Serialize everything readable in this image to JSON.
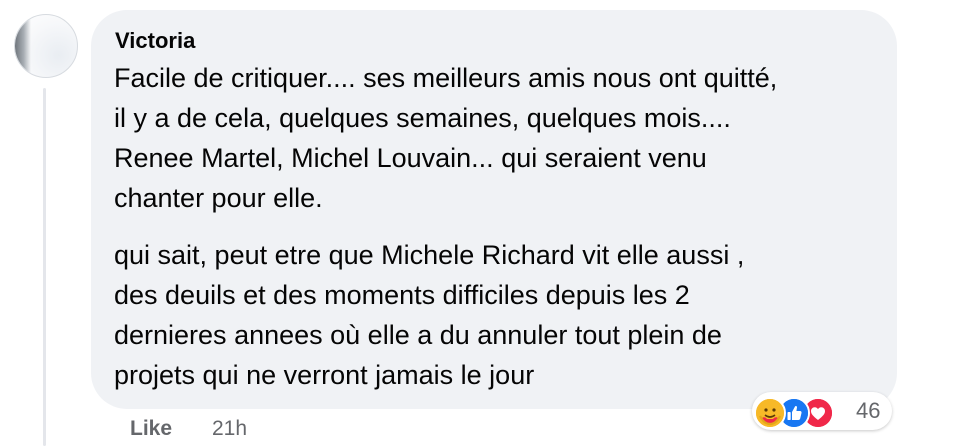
{
  "comment": {
    "author": "Victoria",
    "paragraphs": [
      {
        "lines": [
          "Facile de critiquer.... ses meilleurs amis nous ont quitté,",
          "il y a de cela, quelques semaines, quelques mois....",
          "Renee Martel, Michel Louvain... qui seraient venu",
          "chanter pour elle."
        ]
      },
      {
        "lines": [
          "qui sait, peut etre que Michele Richard vit elle aussi ,",
          "des deuils et des moments difficiles depuis les 2",
          "dernieres annees où elle a du annuler tout plein de",
          "projets qui ne verront jamais le jour"
        ]
      }
    ],
    "actions": {
      "like_label": "Like",
      "timestamp": "21h"
    },
    "reactions": {
      "icons": [
        "care-reaction-icon",
        "like-reaction-icon",
        "love-reaction-icon"
      ],
      "count": "46",
      "colors": {
        "care": "#f7b928",
        "like": "#1877f2",
        "love": "#f02849"
      }
    }
  }
}
